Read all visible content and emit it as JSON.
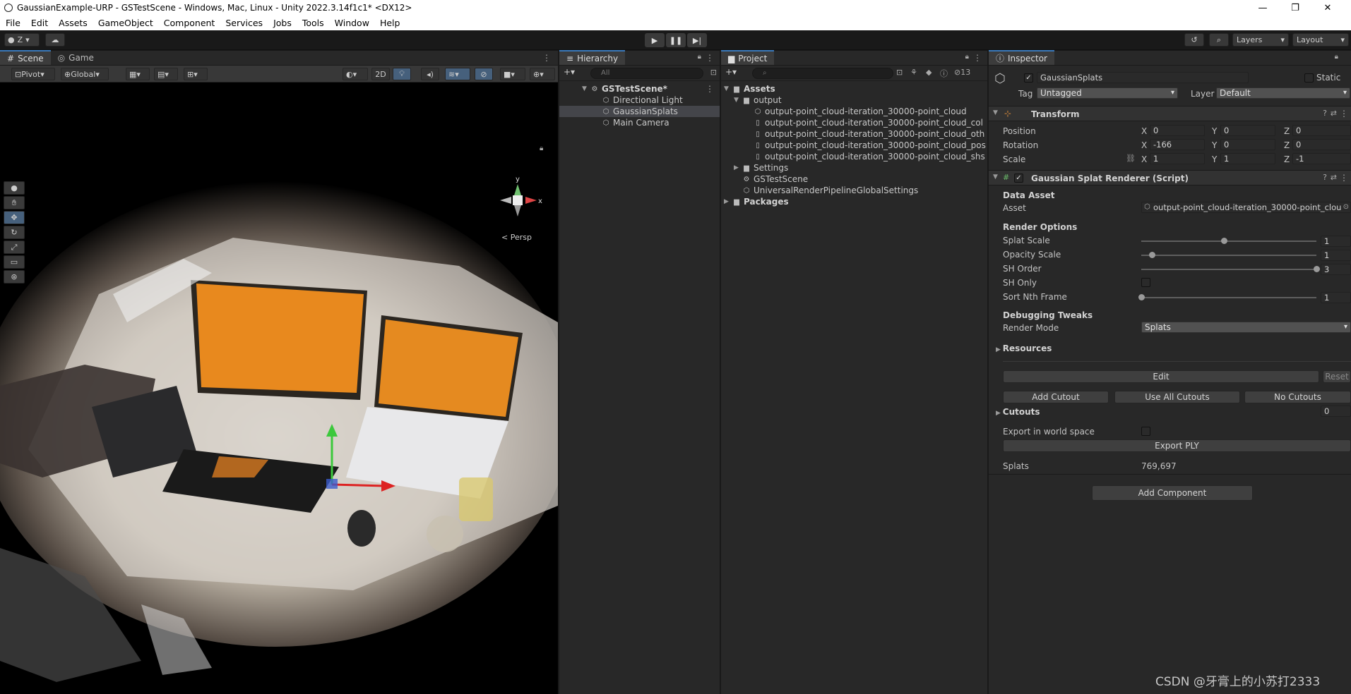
{
  "window": {
    "title": "GaussianExample-URP - GSTestScene - Windows, Mac, Linux - Unity 2022.3.14f1c1* <DX12>",
    "controls": [
      "—",
      "❐",
      "✕"
    ]
  },
  "menu": [
    "File",
    "Edit",
    "Assets",
    "GameObject",
    "Component",
    "Services",
    "Jobs",
    "Tools",
    "Window",
    "Help"
  ],
  "toolbar": {
    "account": "Z",
    "layers": "Layers",
    "layout": "Layout"
  },
  "scene": {
    "tabs": [
      "Scene",
      "Game"
    ],
    "pivot": "Pivot",
    "global": "Global",
    "mode_2d": "2D",
    "persp_label": "Persp",
    "gizmo_axes": {
      "y": "y",
      "x": "x"
    }
  },
  "hierarchy": {
    "tab": "Hierarchy",
    "search_placeholder": "All",
    "scene_name": "GSTestScene*",
    "items": [
      "Directional Light",
      "GaussianSplats",
      "Main Camera"
    ],
    "selected": "GaussianSplats"
  },
  "project": {
    "tab": "Project",
    "hidden_count": "13",
    "tree": {
      "assets": "Assets",
      "output": "output",
      "files": [
        "output-point_cloud-iteration_30000-point_cloud",
        "output-point_cloud-iteration_30000-point_cloud_col",
        "output-point_cloud-iteration_30000-point_cloud_oth",
        "output-point_cloud-iteration_30000-point_cloud_pos",
        "output-point_cloud-iteration_30000-point_cloud_shs"
      ],
      "settings": "Settings",
      "scene": "GSTestScene",
      "urp_settings": "UniversalRenderPipelineGlobalSettings",
      "packages": "Packages"
    }
  },
  "inspector": {
    "tab": "Inspector",
    "object_name": "GaussianSplats",
    "static_label": "Static",
    "tag_label": "Tag",
    "tag_value": "Untagged",
    "layer_label": "Layer",
    "layer_value": "Default",
    "transform": {
      "title": "Transform",
      "position": {
        "label": "Position",
        "x": "0",
        "y": "0",
        "z": "0"
      },
      "rotation": {
        "label": "Rotation",
        "x": "-166",
        "y": "0",
        "z": "0"
      },
      "scale": {
        "label": "Scale",
        "x": "1",
        "y": "1",
        "z": "-1"
      }
    },
    "renderer": {
      "title": "Gaussian Splat Renderer (Script)",
      "data_asset_header": "Data Asset",
      "asset_label": "Asset",
      "asset_value": "output-point_cloud-iteration_30000-point_clou",
      "render_options_header": "Render Options",
      "splat_scale": {
        "label": "Splat Scale",
        "value": "1",
        "fraction": 0.47
      },
      "opacity_scale": {
        "label": "Opacity Scale",
        "value": "1",
        "fraction": 0.06
      },
      "sh_order": {
        "label": "SH Order",
        "value": "3",
        "fraction": 1.0
      },
      "sh_only_label": "SH Only",
      "sort_nth": {
        "label": "Sort Nth Frame",
        "value": "1",
        "fraction": 0.0
      },
      "debug_header": "Debugging Tweaks",
      "render_mode_label": "Render Mode",
      "render_mode_value": "Splats",
      "resources_label": "Resources",
      "edit_button": "Edit",
      "reset_button": "Reset",
      "add_cutout": "Add Cutout",
      "use_all_cutouts": "Use All Cutouts",
      "no_cutouts": "No Cutouts",
      "cutouts_label": "Cutouts",
      "cutouts_count": "0",
      "export_world_label": "Export in world space",
      "export_ply": "Export PLY",
      "splats_label": "Splats",
      "splats_value": "769,697"
    },
    "add_component": "Add Component"
  },
  "watermark": "CSDN @牙膏上的小苏打2333"
}
